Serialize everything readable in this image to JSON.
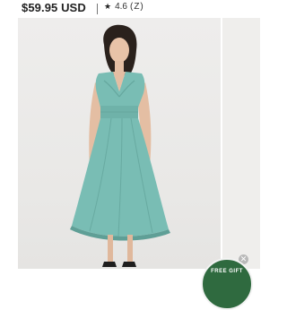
{
  "product": {
    "price": "$59.95 USD",
    "rating": "4.6",
    "review_count": "(Z)"
  },
  "icons": {
    "star": "star-icon",
    "close": "close-icon"
  },
  "badge": {
    "text": "FREE GIFT"
  },
  "colors": {
    "dress": "#79bdb4",
    "badge": "#2f6a3f",
    "background": "#ececea"
  }
}
